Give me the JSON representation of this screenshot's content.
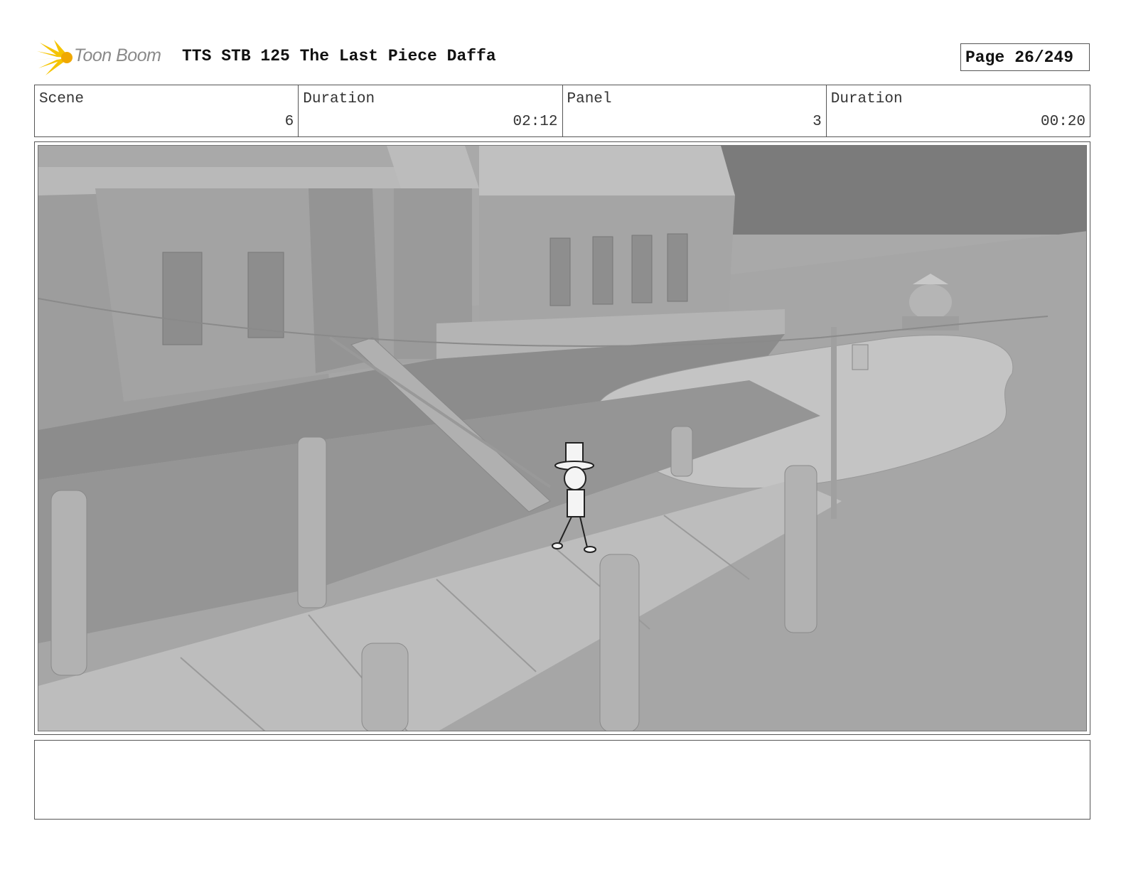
{
  "header": {
    "logo_text": "Toon Boom",
    "title": "TTS STB 125 The Last Piece Daffa",
    "page_label": "Page",
    "page_value": "26/249"
  },
  "info": {
    "scene_label": "Scene",
    "scene_value": "6",
    "scene_duration_label": "Duration",
    "scene_duration_value": "02:12",
    "panel_label": "Panel",
    "panel_value": "3",
    "panel_duration_label": "Duration",
    "panel_duration_value": "00:20"
  },
  "panel_image": {
    "icon": "storyboard-frame-3d-dock-scene"
  },
  "notes": {
    "text": ""
  },
  "colors": {
    "logo_accent": "#f5c400",
    "border": "#555555"
  }
}
